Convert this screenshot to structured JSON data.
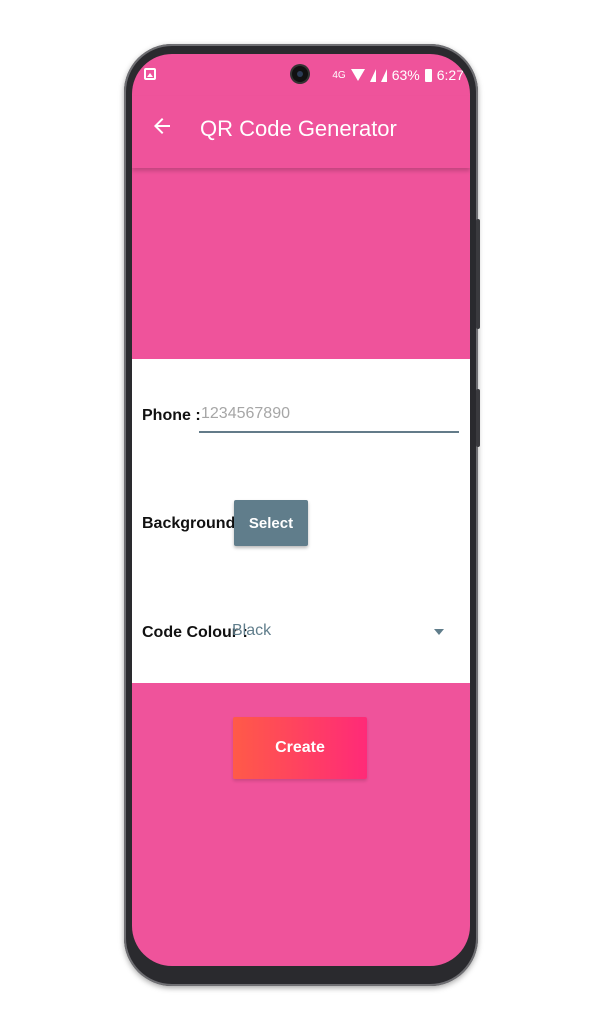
{
  "status_bar": {
    "network": "4G",
    "battery_percent": "63%",
    "time": "6:27"
  },
  "app_bar": {
    "title": "QR Code Generator"
  },
  "form": {
    "phone_label": "Phone :",
    "phone_placeholder": "1234567890",
    "phone_value": "",
    "background_label": "Background :",
    "select_button_label": "Select",
    "code_colour_label": "Code Colour :",
    "code_colour_value": "Black"
  },
  "actions": {
    "create_label": "Create"
  },
  "colors": {
    "primary": "#ef539b",
    "button_grey": "#607d8b",
    "create_gradient_start": "#ff5a48",
    "create_gradient_end": "#ff2a78"
  },
  "icons": {
    "back": "arrow-left-icon",
    "gallery": "gallery-icon",
    "wifi": "wifi-icon",
    "signal": "signal-icon",
    "battery": "battery-icon"
  }
}
